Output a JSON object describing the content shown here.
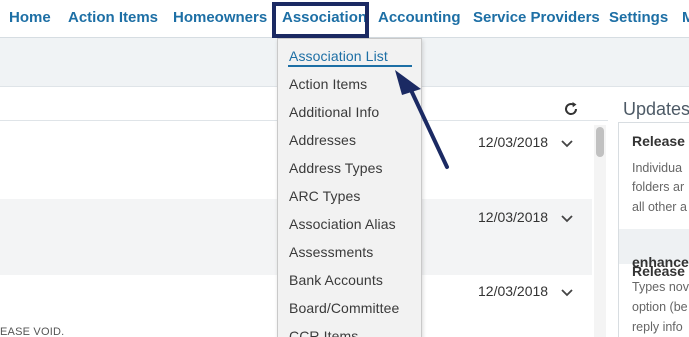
{
  "nav": {
    "items": [
      "Home",
      "Action Items",
      "Homeowners",
      "Association",
      "Accounting",
      "Service Providers",
      "Settings",
      "M"
    ]
  },
  "dropdown": {
    "items": [
      "Association List",
      "Action Items",
      "Additional Info",
      "Addresses",
      "Address Types",
      "ARC Types",
      "Association Alias",
      "Assessments",
      "Bank Accounts",
      "Board/Committee",
      "CCR Items"
    ]
  },
  "list": {
    "rows": [
      {
        "date": "12/03/2018",
        "text": ""
      },
      {
        "date": "12/03/2018",
        "text": ""
      },
      {
        "date": "12/03/2018",
        "text": "EASE VOID."
      }
    ]
  },
  "updates": {
    "title": "Updates",
    "card1_title": "Release N",
    "card1_lines": [
      "Individua",
      "folders ar",
      "all other a"
    ],
    "card2_title_lines": [
      "Release N",
      "enhancem"
    ],
    "card2_lines": [
      "Types nov",
      "option (be",
      "reply info"
    ]
  },
  "colors": {
    "nav_link": "#1d6fa5",
    "highlight_box": "#1b2a63",
    "arrow": "#1b2a63"
  }
}
